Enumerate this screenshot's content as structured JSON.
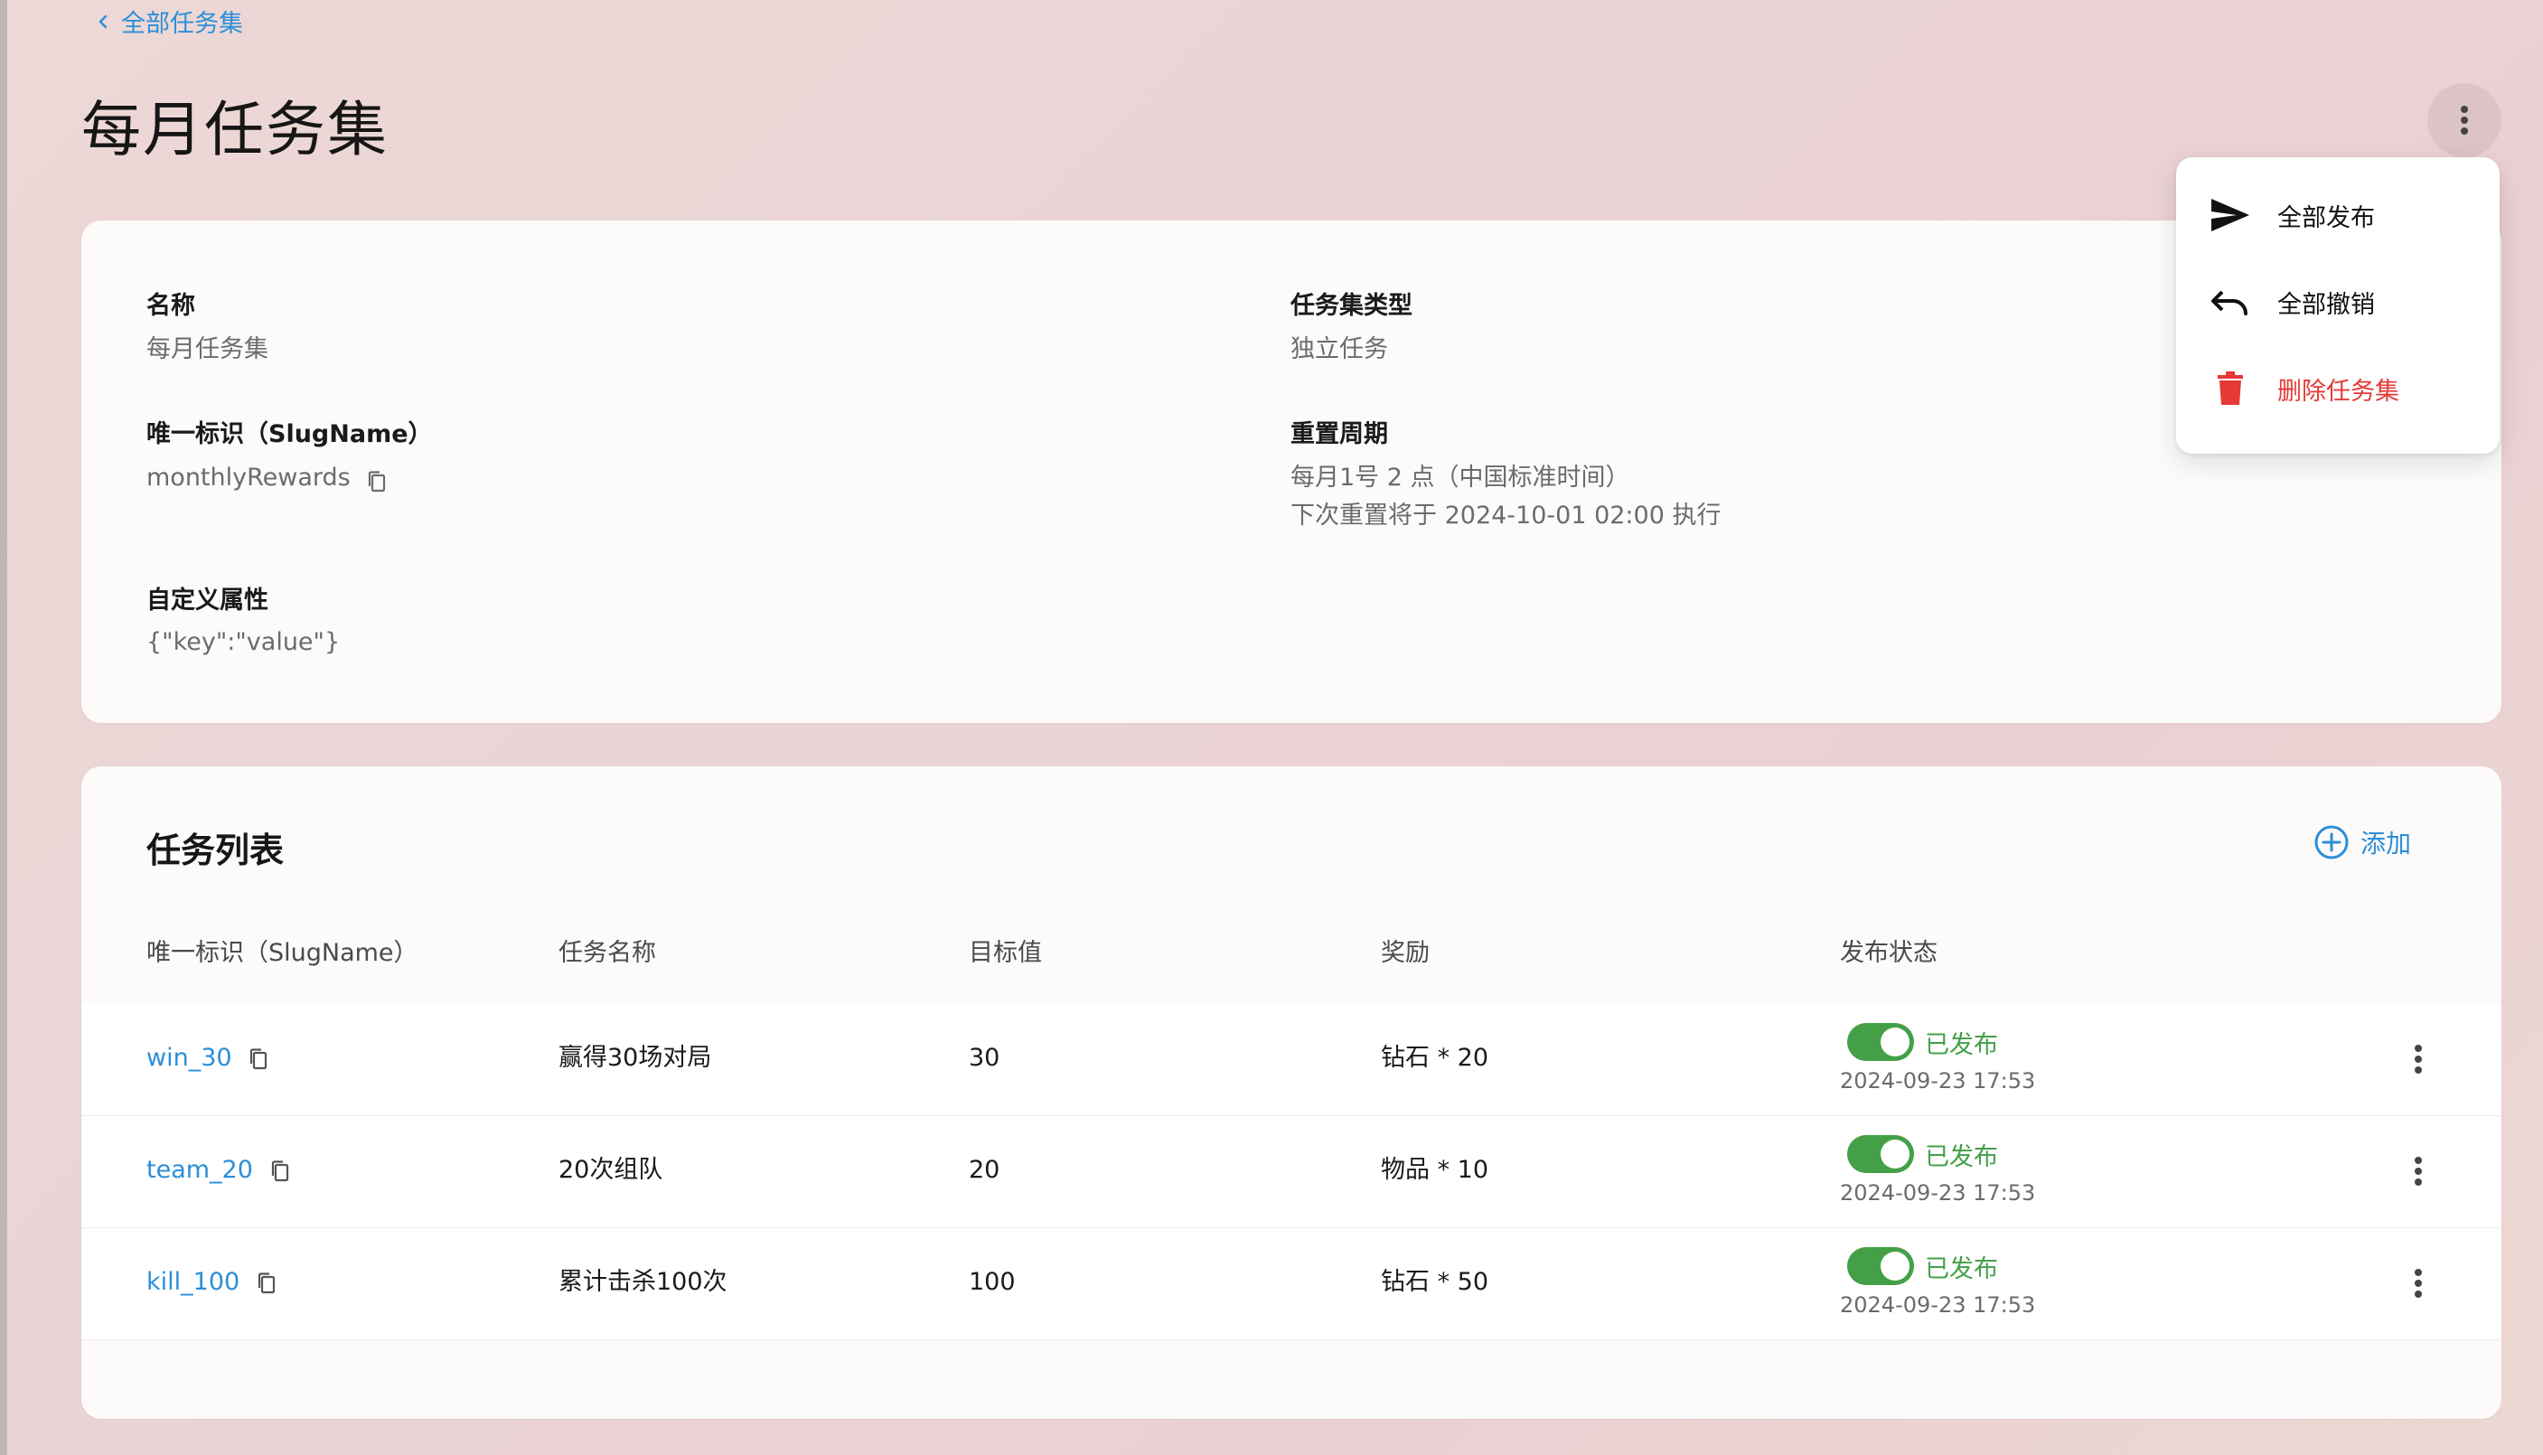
{
  "breadcrumb": {
    "label": "全部任务集"
  },
  "page": {
    "title": "每月任务集"
  },
  "details": {
    "name_label": "名称",
    "name_value": "每月任务集",
    "type_label": "任务集类型",
    "type_value": "独立任务",
    "slug_label": "唯一标识（SlugName）",
    "slug_value": "monthlyRewards",
    "reset_label": "重置周期",
    "reset_value": "每月1号 2 点（中国标准时间）",
    "reset_next": "下次重置将于 2024-10-01 02:00 执行",
    "custom_label": "自定义属性",
    "custom_value": "{\"key\":\"value\"}"
  },
  "menu": {
    "items": [
      {
        "label": "全部发布",
        "icon": "send-icon"
      },
      {
        "label": "全部撤销",
        "icon": "undo-icon"
      },
      {
        "label": "删除任务集",
        "icon": "trash-icon"
      }
    ]
  },
  "tasks": {
    "title": "任务列表",
    "add_label": "添加",
    "columns": [
      "唯一标识（SlugName）",
      "任务名称",
      "目标值",
      "奖励",
      "发布状态"
    ],
    "rows": [
      {
        "slug": "win_30",
        "name": "赢得30场对局",
        "target": "30",
        "reward": "钻石 * 20",
        "status": "已发布",
        "time": "2024-09-23 17:53",
        "published": true
      },
      {
        "slug": "team_20",
        "name": "20次组队",
        "target": "20",
        "reward": "物品 * 10",
        "status": "已发布",
        "time": "2024-09-23 17:53",
        "published": true
      },
      {
        "slug": "kill_100",
        "name": "累计击杀100次",
        "target": "100",
        "reward": "钻石 * 50",
        "status": "已发布",
        "time": "2024-09-23 17:53",
        "published": true
      }
    ]
  },
  "colors": {
    "accent": "#2b8fd8",
    "success": "#43a047",
    "danger": "#e53935"
  }
}
